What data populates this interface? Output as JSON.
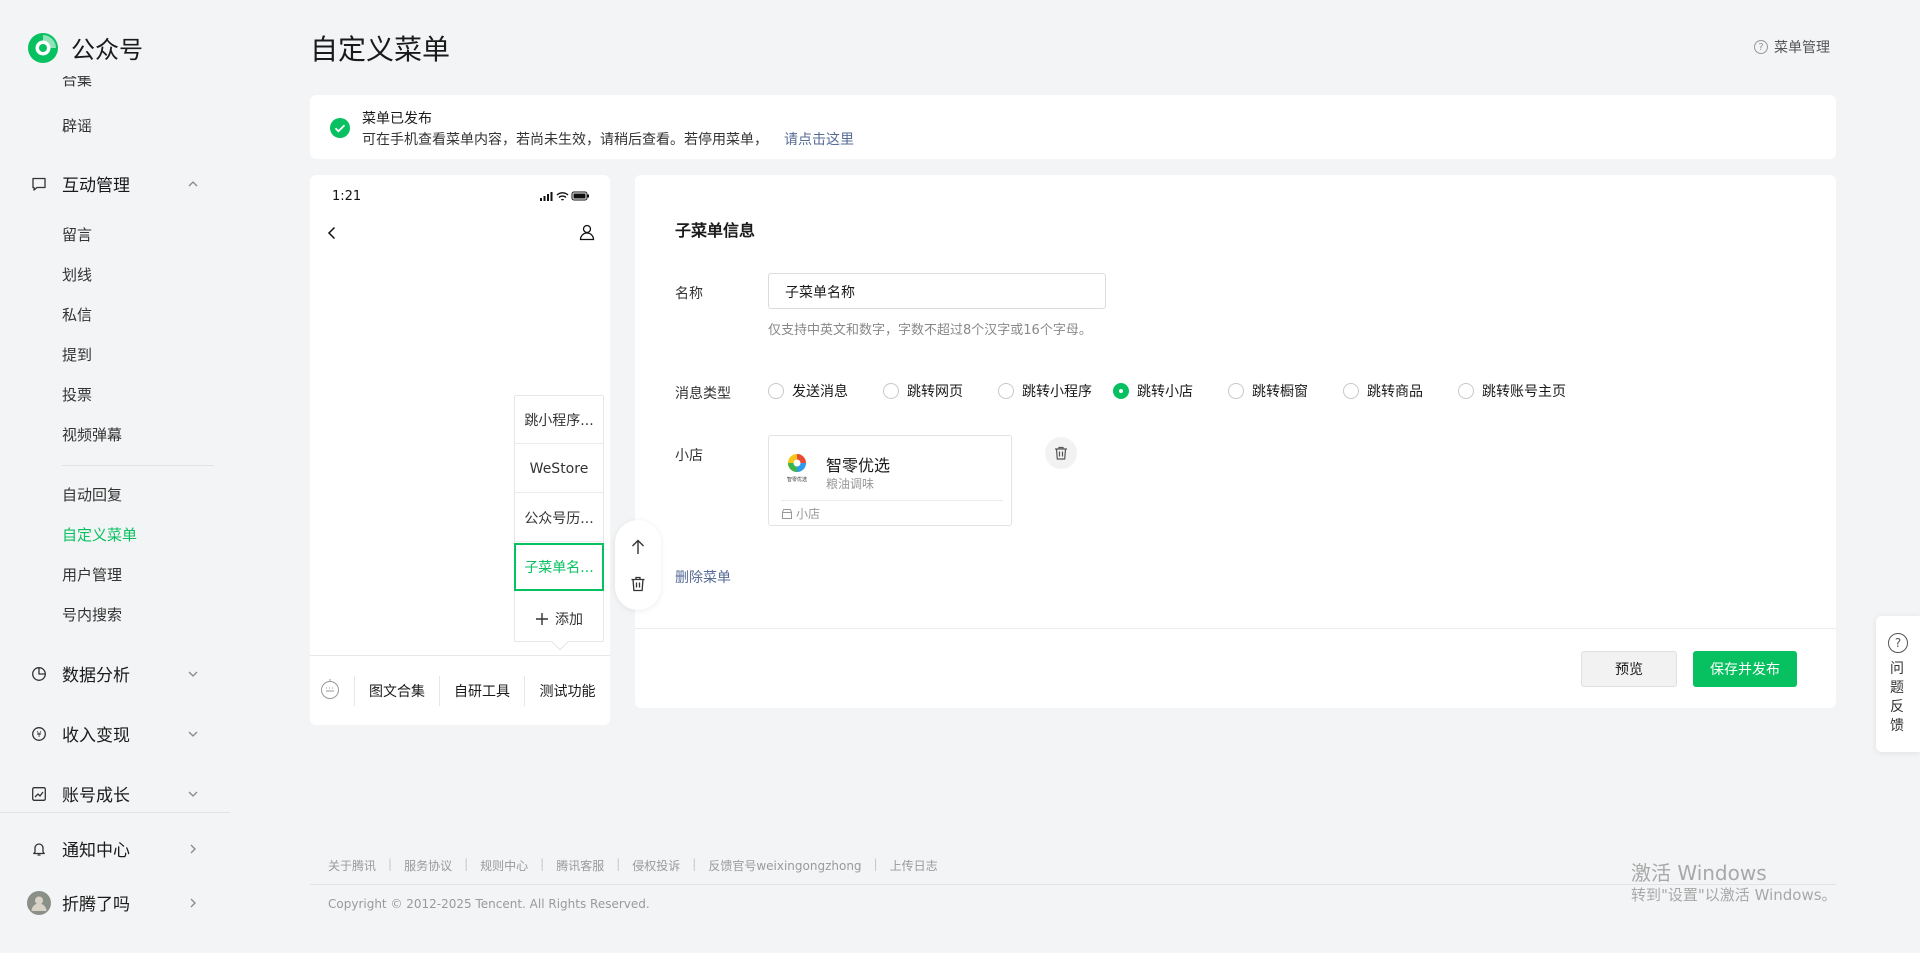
{
  "brand": {
    "name": "公众号",
    "accent": "#07c160",
    "link": "#576b95"
  },
  "sidebar": {
    "cut_item": "合集",
    "items_top": [
      {
        "label": "辟谣"
      }
    ],
    "groups": {
      "interact": {
        "label": "互动管理",
        "icon": "chat-icon"
      },
      "data": {
        "label": "数据分析",
        "icon": "pie-chart-icon"
      },
      "income": {
        "label": "收入变现",
        "icon": "yuan-icon"
      },
      "growth": {
        "label": "账号成长",
        "icon": "trend-icon"
      },
      "notice": {
        "label": "通知中心",
        "icon": "bell-icon"
      },
      "user": {
        "label": "折腾了吗",
        "icon": "avatar"
      }
    },
    "interact_items": [
      "留言",
      "划线",
      "私信",
      "提到",
      "投票",
      "视频弹幕"
    ],
    "tool_items": [
      "自动回复",
      "自定义菜单",
      "用户管理",
      "号内搜索"
    ]
  },
  "header": {
    "title": "自定义菜单",
    "help": "菜单管理"
  },
  "notice": {
    "title": "菜单已发布",
    "desc": "可在手机查看菜单内容，若尚未生效，请稍后查看。若停用菜单，",
    "link": "请点击这里"
  },
  "phone": {
    "time": "1:21",
    "submenu": [
      "跳小程序...",
      "WeStore",
      "公众号历...",
      "子菜单名..."
    ],
    "add_label": "添加",
    "bottom_menu": [
      "图文合集",
      "自研工具",
      "测试功能"
    ]
  },
  "form": {
    "section_title": "子菜单信息",
    "name_label": "名称",
    "name_value": "子菜单名称",
    "name_hint": "仅支持中英文和数字，字数不超过8个汉字或16个字母。",
    "type_label": "消息类型",
    "types": [
      "发送消息",
      "跳转网页",
      "跳转小程序",
      "跳转小店",
      "跳转橱窗",
      "跳转商品",
      "跳转账号主页"
    ],
    "selected_type": "跳转小店",
    "shop_label": "小店",
    "shop": {
      "name": "智零优选",
      "category": "粮油调味",
      "tag": "小店",
      "logo_text": "智零优选"
    },
    "delete_label": "删除菜单",
    "preview_label": "预览",
    "save_label": "保存并发布"
  },
  "footer": {
    "links": [
      "关于腾讯",
      "服务协议",
      "规则中心",
      "腾讯客服",
      "侵权投诉",
      "反馈官号weixingongzhong",
      "上传日志"
    ],
    "copyright": "Copyright © 2012-2025 Tencent. All Rights Reserved."
  },
  "feedback": {
    "label": "问题反馈"
  },
  "watermark": {
    "line1": "激活 Windows",
    "line2": "转到\"设置\"以激活 Windows。"
  }
}
